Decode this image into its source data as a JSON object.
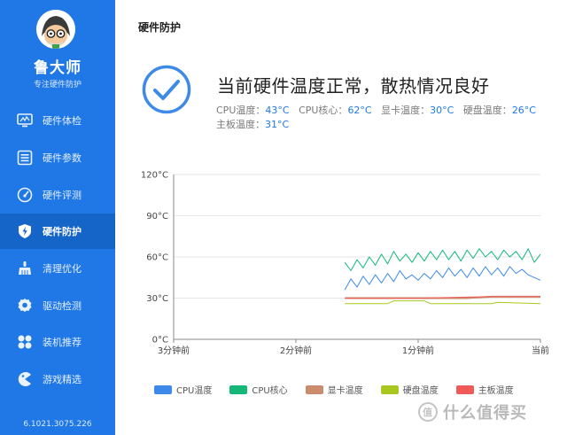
{
  "sidebar": {
    "brand": "鲁大师",
    "tagline": "专注硬件防护",
    "version": "6.1021.3075.226",
    "items": [
      {
        "label": "硬件体检",
        "icon": "monitor-icon"
      },
      {
        "label": "硬件参数",
        "icon": "list-icon"
      },
      {
        "label": "硬件评测",
        "icon": "gauge-icon"
      },
      {
        "label": "硬件防护",
        "icon": "shield-bolt-icon",
        "active": true
      },
      {
        "label": "清理优化",
        "icon": "broom-icon"
      },
      {
        "label": "驱动检测",
        "icon": "gear-icon"
      },
      {
        "label": "装机推荐",
        "icon": "puzzle-icon"
      },
      {
        "label": "游戏精选",
        "icon": "game-icon"
      }
    ]
  },
  "main": {
    "title": "硬件防护",
    "status_headline": "当前硬件温度正常，散热情况良好",
    "temps": [
      {
        "label": "CPU温度：",
        "value": "43°C"
      },
      {
        "label": "CPU核心：",
        "value": "62°C"
      },
      {
        "label": "显卡温度：",
        "value": "30°C"
      },
      {
        "label": "硬盘温度：",
        "value": "26°C"
      },
      {
        "label": "主板温度：",
        "value": "31°C"
      }
    ]
  },
  "watermark": "什么值得买",
  "colors": {
    "sidebar": "#1f78e6",
    "sidebar_active": "#1565c8",
    "accent": "#1f78e6"
  },
  "chart_data": {
    "type": "line",
    "x_labels": [
      "3分钟前",
      "2分钟前",
      "1分钟前",
      "当前"
    ],
    "x_range": [
      -3,
      0
    ],
    "ylim": [
      0,
      120
    ],
    "y_ticks": [
      {
        "value": 0,
        "label": "0°C"
      },
      {
        "value": 30,
        "label": "30°C"
      },
      {
        "value": 60,
        "label": "60°C"
      },
      {
        "value": 90,
        "label": "90°C"
      },
      {
        "value": 120,
        "label": "120°C"
      }
    ],
    "grid": true,
    "legend_position": "bottom",
    "series": [
      {
        "name": "CPU温度",
        "color": "#3d8ae8",
        "width": 1,
        "x": [
          -1.6,
          -1.55,
          -1.5,
          -1.45,
          -1.4,
          -1.35,
          -1.3,
          -1.25,
          -1.2,
          -1.15,
          -1.1,
          -1.05,
          -1,
          -0.95,
          -0.9,
          -0.85,
          -0.8,
          -0.75,
          -0.7,
          -0.65,
          -0.6,
          -0.55,
          -0.5,
          -0.45,
          -0.4,
          -0.35,
          -0.3,
          -0.25,
          -0.2,
          -0.15,
          -0.1,
          -0.05,
          0
        ],
        "y": [
          36,
          44,
          38,
          46,
          40,
          47,
          41,
          48,
          42,
          50,
          44,
          47,
          43,
          48,
          44,
          50,
          45,
          52,
          46,
          51,
          45,
          52,
          46,
          53,
          47,
          52,
          46,
          53,
          48,
          51,
          47,
          45,
          43
        ]
      },
      {
        "name": "CPU核心",
        "color": "#14b97a",
        "width": 1,
        "x": [
          -1.6,
          -1.55,
          -1.5,
          -1.45,
          -1.4,
          -1.35,
          -1.3,
          -1.25,
          -1.2,
          -1.15,
          -1.1,
          -1.05,
          -1,
          -0.95,
          -0.9,
          -0.85,
          -0.8,
          -0.75,
          -0.7,
          -0.65,
          -0.6,
          -0.55,
          -0.5,
          -0.45,
          -0.4,
          -0.35,
          -0.3,
          -0.25,
          -0.2,
          -0.15,
          -0.1,
          -0.05,
          0
        ],
        "y": [
          56,
          50,
          58,
          52,
          60,
          54,
          62,
          55,
          64,
          57,
          62,
          56,
          63,
          57,
          64,
          58,
          65,
          58,
          64,
          57,
          65,
          59,
          66,
          60,
          64,
          58,
          65,
          60,
          64,
          58,
          66,
          56,
          62
        ]
      },
      {
        "name": "显卡温度",
        "color": "#c98c6c",
        "width": 2,
        "x": [
          -1.6,
          -1.2,
          -1.0,
          -0.6,
          -0.4,
          0
        ],
        "y": [
          30,
          30,
          30,
          30,
          31,
          31
        ]
      },
      {
        "name": "硬盘温度",
        "color": "#a8c81f",
        "width": 1,
        "x": [
          -1.6,
          -1.25,
          -1.2,
          -0.95,
          -0.9,
          -0.4,
          -0.35,
          0
        ],
        "y": [
          26,
          26,
          28,
          28,
          26,
          26,
          27,
          26
        ]
      },
      {
        "name": "主板温度",
        "color": "#f05a5a",
        "width": 1,
        "x": [
          -1.6,
          -1.0,
          -0.4,
          0
        ],
        "y": [
          30,
          30,
          31,
          31
        ]
      }
    ]
  }
}
